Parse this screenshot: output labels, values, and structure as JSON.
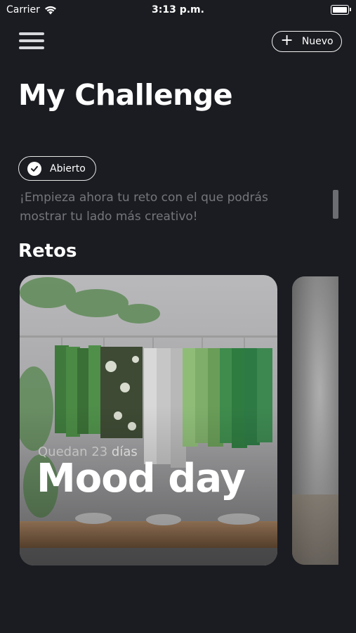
{
  "status_bar": {
    "carrier": "Carrier",
    "time": "3:13 p.m."
  },
  "header": {
    "new_button_label": "Nuevo"
  },
  "page": {
    "title": "My Challenge",
    "status_label": "Abierto",
    "description": "¡Empieza ahora tu reto con el que podrás mostrar tu lado más creativo!"
  },
  "section": {
    "title": "Retos"
  },
  "cards": [
    {
      "remaining_prefix": "Quedan",
      "remaining_number": "23",
      "remaining_suffix": "días",
      "title": "Mood day"
    }
  ],
  "colors": {
    "background": "#1b1c21",
    "text": "#ffffff",
    "muted_text": "#75767c"
  }
}
